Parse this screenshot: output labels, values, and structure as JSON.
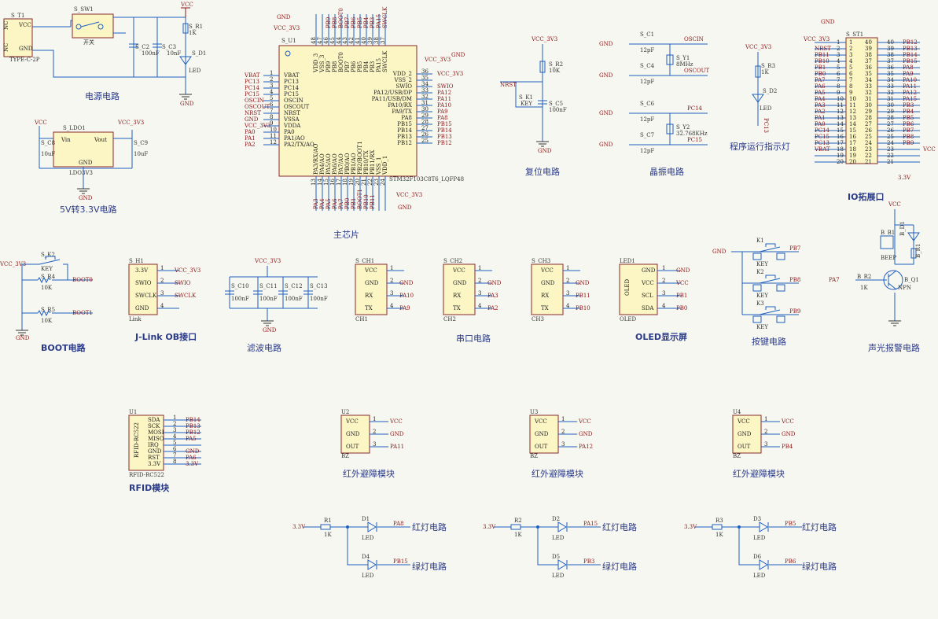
{
  "captions": {
    "power": "电源电路",
    "ldo": "5V转3.3V电路",
    "mcu": "主芯片",
    "reset": "复位电路",
    "crystal": "晶振电路",
    "led_ind": "程序运行指示灯",
    "io": "IO拓展口",
    "boot": "BOOT电路",
    "jlink": "J-Link OB接口",
    "filter": "滤波电路",
    "uart": "串口电路",
    "oled": "OLED显示屏",
    "keys": "按键电路",
    "alarm": "声光报警电路",
    "rfid": "RFID模块",
    "ir1": "红外避障模块",
    "ir2": "红外避障模块",
    "ir3": "红外避障模块",
    "red1": "红灯电路",
    "green1": "绿灯电路",
    "red2": "红灯电路",
    "green2": "绿灯电路",
    "red3": "红灯电路",
    "green3": "绿灯电路"
  },
  "power": {
    "t1": "S_T1",
    "t1_type": "TYPE-C-2P",
    "nc1": "NC",
    "nc2": "NC",
    "vcc": "VCC",
    "gnd": "GND",
    "sw": "S_SW1",
    "sw_name": "开关",
    "c2": "S_C2",
    "c2v": "100nF",
    "c3": "S_C3",
    "c3v": "10nF",
    "r1": "S_R1",
    "r1v": "1K",
    "d1": "S_D1",
    "d1v": "LED",
    "vcc_net": "VCC",
    "gnd_net": "GND"
  },
  "ldo": {
    "name": "S_LDO1",
    "part": "LDO3V3",
    "vin": "Vin",
    "vout": "Vout",
    "gnd": "GND",
    "c8": "S_C8",
    "c8v": "10uF",
    "c9": "S_C9",
    "c9v": "10uF",
    "vcc": "VCC",
    "vcc33": "VCC_3V3",
    "gnd_net": "GND"
  },
  "mcu": {
    "name": "S_U1",
    "part": "STM32F103C8T6_LQFP48",
    "vcc": "VCC_3V3",
    "gnd": "GND",
    "left": [
      [
        "VBAT",
        "1",
        "VBAT"
      ],
      [
        "PC13",
        "2",
        "PC13"
      ],
      [
        "PC14",
        "3",
        "PC14"
      ],
      [
        "PC15",
        "4",
        "PC15"
      ],
      [
        "OSCIN",
        "5",
        "OSCIN"
      ],
      [
        "OSCOUT",
        "6",
        "OSCOUT"
      ],
      [
        "NRST",
        "7",
        "NRST"
      ],
      [
        "VSSA",
        "8",
        "GND"
      ],
      [
        "VDDA",
        "9",
        "VCC_3V3"
      ],
      [
        "PA0",
        "10",
        "PA0"
      ],
      [
        "PA1/AO",
        "11",
        "PA1"
      ],
      [
        "PA2/TX/AO",
        "12",
        "PA2"
      ]
    ],
    "right": [
      [
        "VDD_2",
        "36",
        "VCC_3V3"
      ],
      [
        "VSS_2",
        "35",
        ""
      ],
      [
        "SWIO",
        "34",
        "SWIO"
      ],
      [
        "PA12/USB/DP",
        "33",
        "PA12"
      ],
      [
        "PA11/USB/DM",
        "32",
        "PA11"
      ],
      [
        "PA10/RX",
        "31",
        "PA10"
      ],
      [
        "PA9/TX",
        "30",
        "PA9"
      ],
      [
        "PA8",
        "29",
        "PA8"
      ],
      [
        "PB15",
        "28",
        "PB15"
      ],
      [
        "PB14",
        "27",
        "PB14"
      ],
      [
        "PB13",
        "26",
        "PB13"
      ],
      [
        "PB12",
        "25",
        "PB12"
      ]
    ],
    "top": [
      [
        "VDD_3",
        "48",
        ""
      ],
      [
        "VSS_3",
        "47",
        ""
      ],
      [
        "PB9",
        "46",
        "PB9"
      ],
      [
        "PB8",
        "45",
        "PB8"
      ],
      [
        "BOOT0",
        "44",
        "BOOT0"
      ],
      [
        "PB7",
        "43",
        "PB7"
      ],
      [
        "PB6",
        "42",
        "PB6"
      ],
      [
        "PB5",
        "41",
        "PB5"
      ],
      [
        "PB4",
        "40",
        "PB4"
      ],
      [
        "PB3",
        "39",
        "PB3"
      ],
      [
        "PA15",
        "38",
        "PA15"
      ],
      [
        "SWCLK",
        "37",
        "SWCLK"
      ]
    ],
    "bottom": [
      [
        "PA3/RX/AO",
        "13",
        "PA3"
      ],
      [
        "PA4/AO",
        "14",
        "PA4"
      ],
      [
        "PA5/AO",
        "15",
        "PA5"
      ],
      [
        "PA6/AO",
        "16",
        "PA6"
      ],
      [
        "PA7/AO",
        "17",
        "PA7"
      ],
      [
        "PB0/AO",
        "18",
        "PB0"
      ],
      [
        "PB1/AO",
        "19",
        "PB1"
      ],
      [
        "PB2/BOOT1",
        "20",
        "BOOT1"
      ],
      [
        "PB10/TX",
        "21",
        "PB10"
      ],
      [
        "PB11/RX",
        "22",
        "PB11"
      ],
      [
        "VSS_1",
        "23",
        ""
      ],
      [
        "VDD_1",
        "24",
        ""
      ]
    ],
    "bvcc": "VCC_3V3",
    "bgnd": "GND"
  },
  "reset": {
    "vcc": "VCC_3V3",
    "nrst": "NRST",
    "r2": "S_R2",
    "r2v": "10K",
    "k1": "S_K1",
    "k1v": "KEY",
    "c5": "S_C5",
    "c5v": "100nF",
    "gnd": "GND"
  },
  "crystal": {
    "c1": "S_C1",
    "c4": "S_C4",
    "c6": "S_C6",
    "c7": "S_C7",
    "cv": "12pF",
    "y1": "S_Y1",
    "y1v": "8MHz",
    "y2": "S_Y2",
    "y2v": "32.768KHz",
    "oscin": "OSCIN",
    "oscout": "OSCOUT",
    "pc14": "PC14",
    "pc15": "PC15",
    "gnd": "GND"
  },
  "ledind": {
    "vcc": "VCC_3V3",
    "r3": "S_R3",
    "r3v": "1K",
    "d2": "S_D2",
    "d2v": "LED",
    "pc13": "PC13"
  },
  "io": {
    "name": "S_ST1",
    "vcc33": "VCC_3V3",
    "gnd": "GND",
    "vcc": "VCC",
    "v33": "3.3V",
    "left": [
      "NRST",
      "PB11",
      "PB10",
      "PB1",
      "PB0",
      "PA7",
      "PA6",
      "PA5",
      "PA4",
      "PA3",
      "PA2",
      "PA1",
      "PA0",
      "PC14",
      "PC15",
      "PC13",
      "VBAT"
    ],
    "right": [
      "PB12",
      "PB13",
      "PB14",
      "PB15",
      "PA8",
      "PA9",
      "PA10",
      "PA11",
      "PA12",
      "PA15",
      "PB3",
      "PB4",
      "PB5",
      "PB6",
      "PB7",
      "PB8",
      "PB9"
    ]
  },
  "boot": {
    "vcc": "VCC_3V3",
    "k2": "S_K2",
    "k2v": "KEY",
    "r4": "S_R4",
    "r4v": "10K",
    "r5": "S_R5",
    "r5v": "10K",
    "boot0": "BOOT0",
    "boot1": "BOOT1",
    "gnd": "GND"
  },
  "jlink": {
    "name": "S_H1",
    "part": "Link",
    "pins": [
      [
        "3.3V",
        "1",
        "VCC_3V3"
      ],
      [
        "SWIO",
        "2",
        "SWIO"
      ],
      [
        "SWCLK",
        "3",
        "SWCLK"
      ],
      [
        "GND",
        "4",
        ""
      ]
    ]
  },
  "filter": {
    "vcc": "VCC_3V3",
    "caps": [
      [
        "S_C10",
        "100nF"
      ],
      [
        "S_C11",
        "100nF"
      ],
      [
        "S_C12",
        "100nF"
      ],
      [
        "S_C13",
        "100nF"
      ]
    ],
    "gnd": "GND"
  },
  "uart": [
    {
      "name": "S_CH1",
      "foot": "CH1",
      "pins": [
        [
          "VCC",
          "1",
          ""
        ],
        [
          "GND",
          "2",
          "GND"
        ],
        [
          "RX",
          "3",
          "PA10"
        ],
        [
          "TX",
          "4",
          "PA9"
        ]
      ]
    },
    {
      "name": "S_CH2",
      "foot": "CH2",
      "pins": [
        [
          "VCC",
          "1",
          ""
        ],
        [
          "GND",
          "2",
          "GND"
        ],
        [
          "RX",
          "3",
          "PA3"
        ],
        [
          "TX",
          "4",
          "PA2"
        ]
      ]
    },
    {
      "name": "S_CH3",
      "foot": "CH3",
      "pins": [
        [
          "VCC",
          "1",
          ""
        ],
        [
          "GND",
          "2",
          "GND"
        ],
        [
          "RX",
          "3",
          "PB11"
        ],
        [
          "TX",
          "4",
          "PB10"
        ]
      ]
    }
  ],
  "oled": {
    "name": "LED1",
    "foot": "OLED",
    "body": "OLED",
    "pins": [
      [
        "GND",
        "1",
        "GND"
      ],
      [
        "VCC",
        "2",
        "VCC"
      ],
      [
        "SCL",
        "3",
        "PB1"
      ],
      [
        "SDA",
        "4",
        "PB0"
      ]
    ]
  },
  "keys": {
    "gnd": "GND",
    "k": [
      [
        "K1",
        "PB7"
      ],
      [
        "K2",
        "PB8"
      ],
      [
        "K3",
        "PB9"
      ]
    ],
    "kv": "KEY"
  },
  "alarm": {
    "vcc": "VCC",
    "b1": "B_B1",
    "b1v": "BEEP",
    "d1": "B_D1",
    "r1": "B_R1",
    "r2": "B_R2",
    "r2v": "1K",
    "q1": "B_Q1",
    "q1v": "NPN",
    "pa7": "PA7"
  },
  "rfid": {
    "name": "U1",
    "part": "RFID-RC522",
    "body": "RFID-RC522",
    "pins": [
      [
        "SDA",
        "1",
        "PB14"
      ],
      [
        "SCK",
        "2",
        "PB13"
      ],
      [
        "MOSI",
        "3",
        "PB12"
      ],
      [
        "MISO",
        "4",
        "PA5"
      ],
      [
        "IRQ",
        "5",
        ""
      ],
      [
        "GND",
        "6",
        "GND"
      ],
      [
        "RST",
        "7",
        "PA6"
      ],
      [
        "3.3V",
        "8",
        "3.3V"
      ]
    ]
  },
  "ir": [
    {
      "name": "U2",
      "foot": "BZ",
      "out": "PA11"
    },
    {
      "name": "U3",
      "foot": "BZ",
      "out": "PA12"
    },
    {
      "name": "U4",
      "foot": "BZ",
      "out": "PB4"
    }
  ],
  "ir_pins": {
    "vcc": "VCC",
    "gnd": "GND",
    "out": "OUT",
    "net_gnd": "GND"
  },
  "leds": [
    {
      "r": "R1",
      "d_red": "D1",
      "d_green": "D4",
      "red_net": "PA8",
      "green_net": "PB15"
    },
    {
      "r": "R2",
      "d_red": "D2",
      "d_green": "D5",
      "red_net": "PA15",
      "green_net": "PB3"
    },
    {
      "r": "R3",
      "d_red": "D3",
      "d_green": "D6",
      "red_net": "PB5",
      "green_net": "PB6"
    }
  ],
  "led_common": {
    "v": "3.3V",
    "rv": "1K",
    "dv": "LED"
  }
}
